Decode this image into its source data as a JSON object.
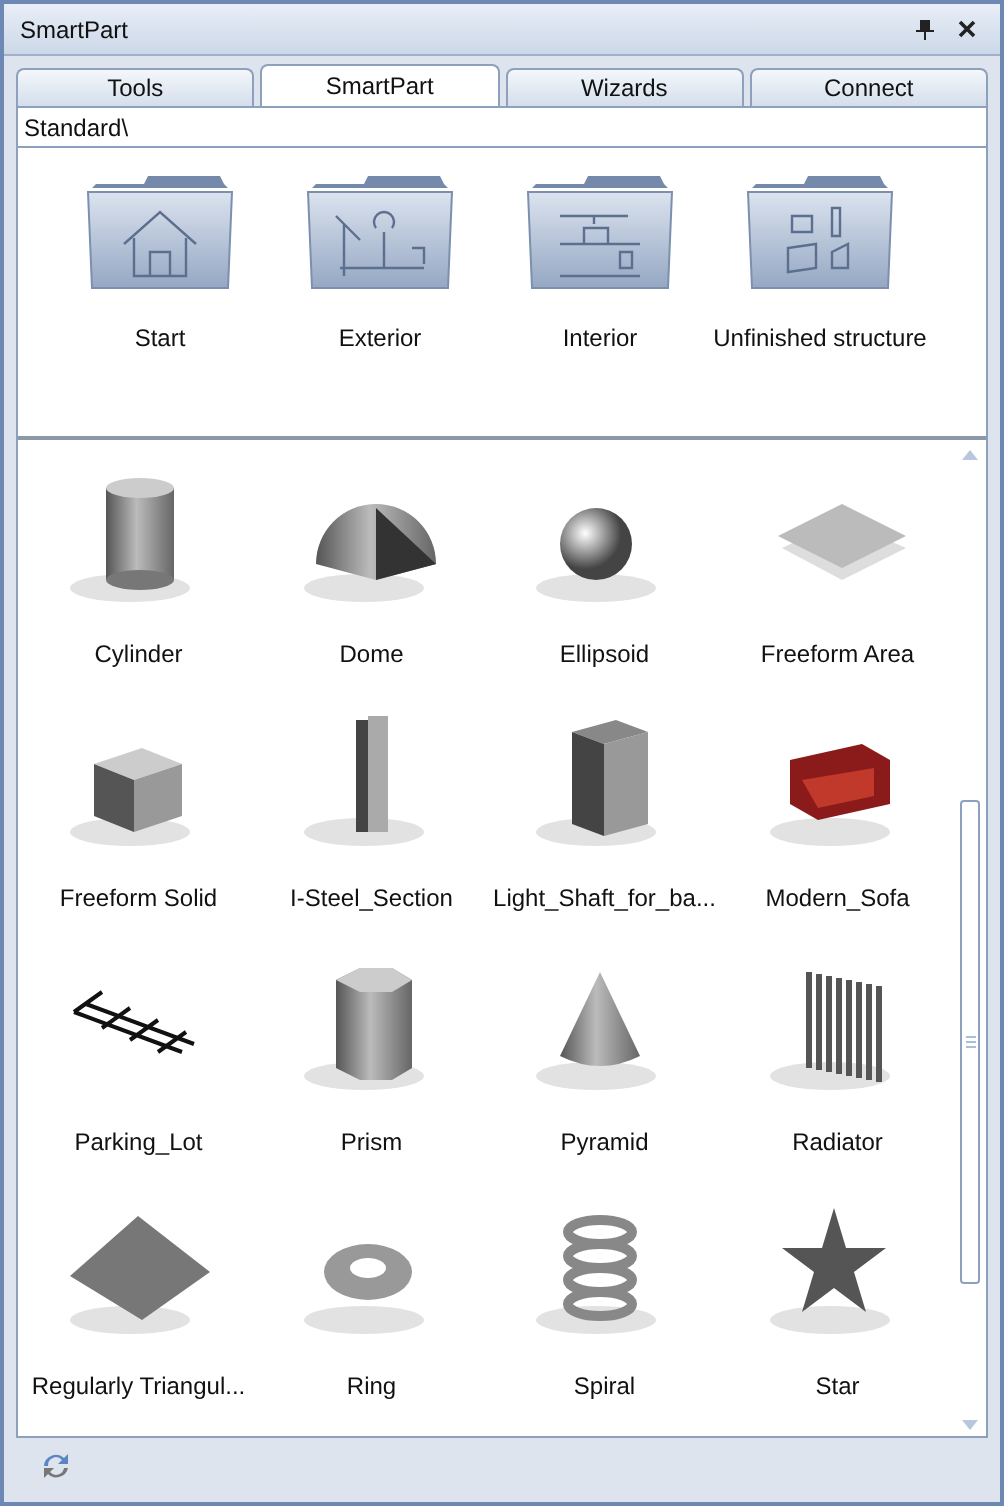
{
  "window": {
    "title": "SmartPart"
  },
  "tabs": [
    {
      "label": "Tools",
      "selected": false
    },
    {
      "label": "SmartPart",
      "selected": true
    },
    {
      "label": "Wizards",
      "selected": false
    },
    {
      "label": "Connect",
      "selected": false
    }
  ],
  "path": "Standard\\",
  "folders": [
    {
      "label": "Start"
    },
    {
      "label": "Exterior"
    },
    {
      "label": "Interior"
    },
    {
      "label": "Unfinished structure"
    }
  ],
  "items": [
    {
      "label": "Cylinder"
    },
    {
      "label": "Dome"
    },
    {
      "label": "Ellipsoid"
    },
    {
      "label": "Freeform Area"
    },
    {
      "label": "Freeform Solid"
    },
    {
      "label": "I-Steel_Section"
    },
    {
      "label": "Light_Shaft_for_ba..."
    },
    {
      "label": "Modern_Sofa"
    },
    {
      "label": "Parking_Lot"
    },
    {
      "label": "Prism"
    },
    {
      "label": "Pyramid"
    },
    {
      "label": "Radiator"
    },
    {
      "label": "Regularly Triangul..."
    },
    {
      "label": "Ring"
    },
    {
      "label": "Spiral"
    },
    {
      "label": "Star"
    }
  ]
}
